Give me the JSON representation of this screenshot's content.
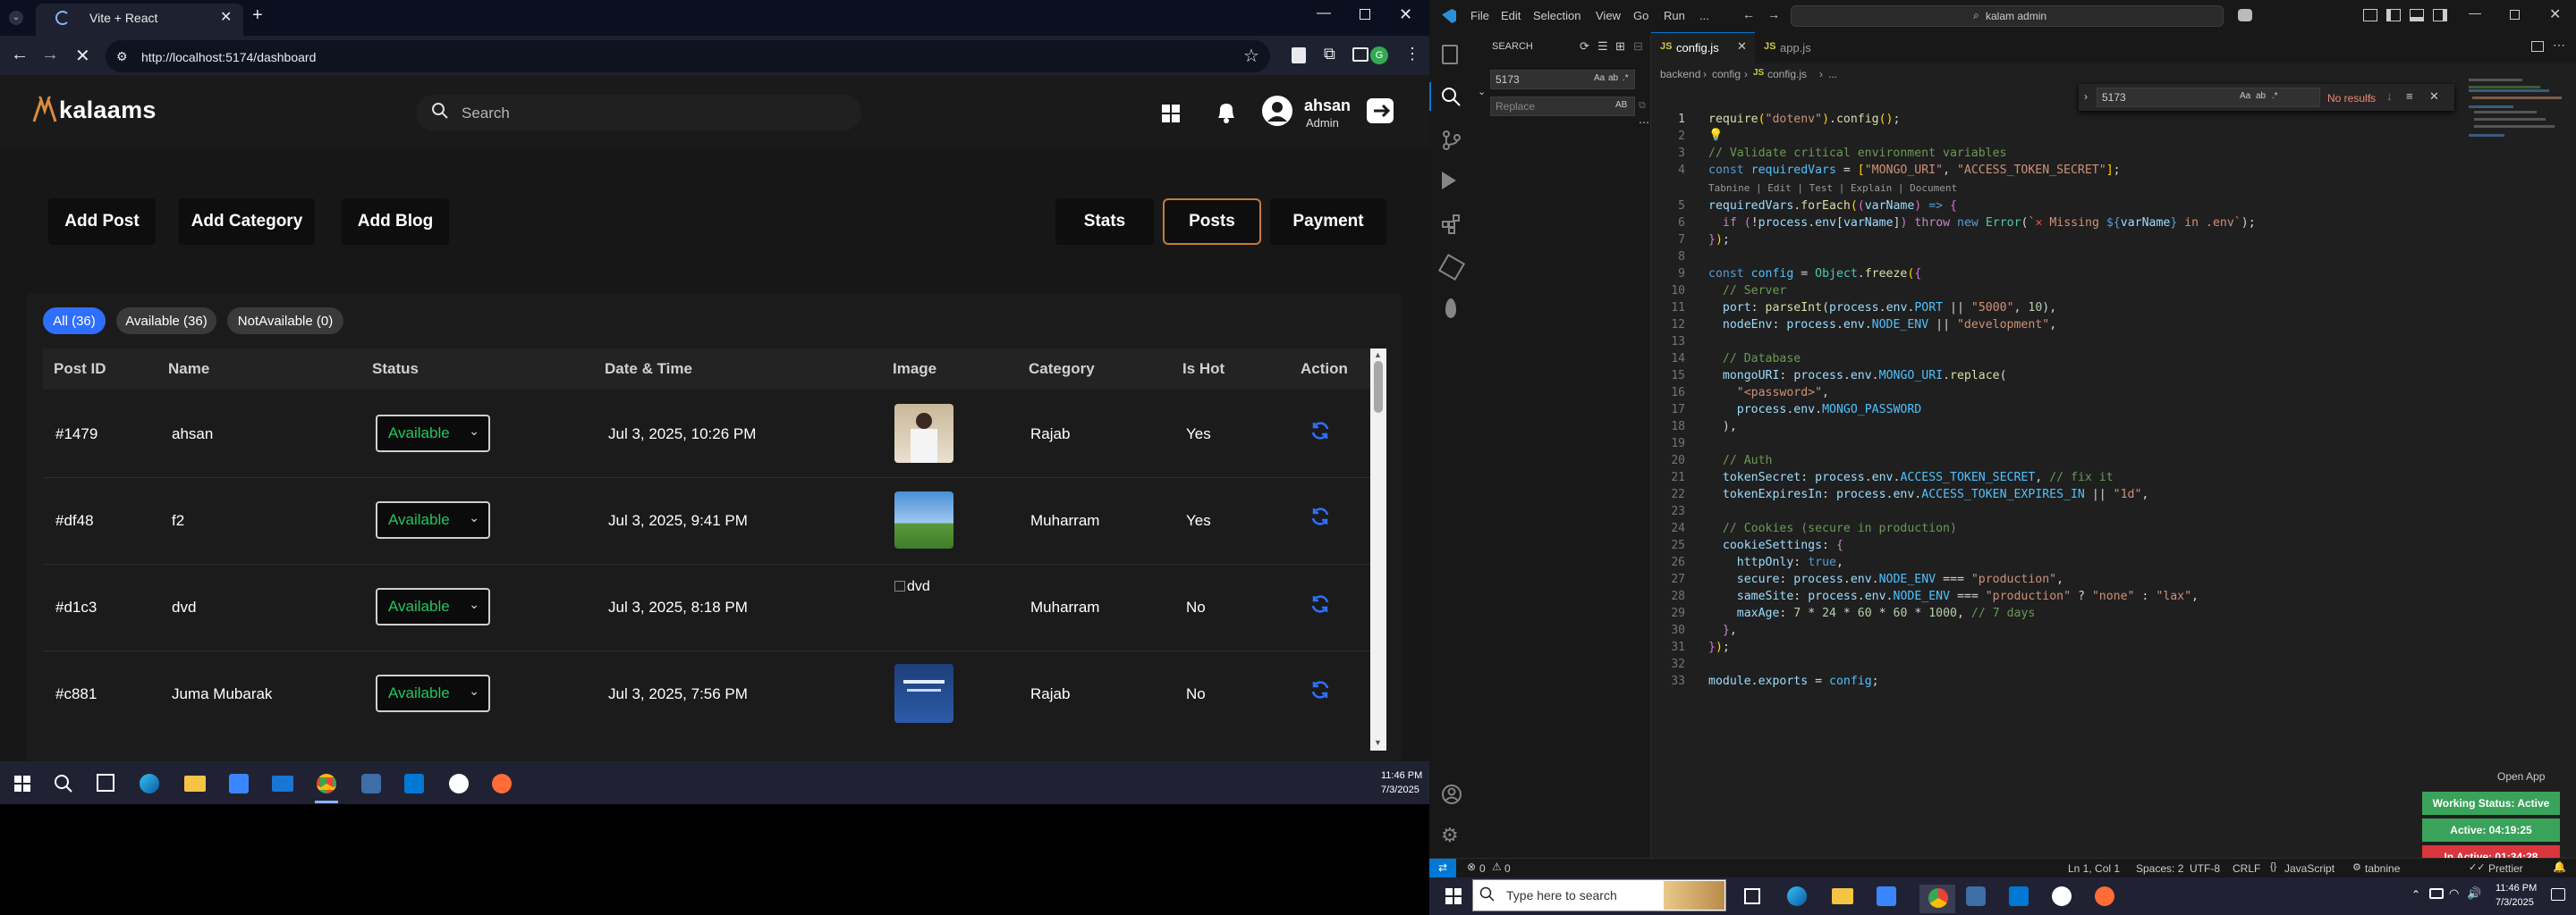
{
  "browser": {
    "tab_title": "Vite + React",
    "url": "http://localhost:5174/dashboard"
  },
  "app": {
    "logo": "kalaams",
    "search_placeholder": "Search",
    "user_name": "ahsan",
    "user_role": "Admin",
    "action_buttons": [
      "Add Post",
      "Add Category",
      "Add Blog"
    ],
    "view_buttons": [
      "Stats",
      "Posts",
      "Payment"
    ],
    "active_view": "Posts",
    "filters": [
      "All (36)",
      "Available (36)",
      "NotAvailable (0)"
    ],
    "columns": [
      "Post ID",
      "Name",
      "Status",
      "Date & Time",
      "Image",
      "Category",
      "Is Hot",
      "Action"
    ],
    "rows": [
      {
        "id": "#1479",
        "name": "ahsan",
        "status": "Available",
        "date": "Jul 3, 2025, 10:26 PM",
        "image_alt": "",
        "category": "Rajab",
        "is_hot": "Yes"
      },
      {
        "id": "#df48",
        "name": "f2",
        "status": "Available",
        "date": "Jul 3, 2025, 9:41 PM",
        "image_alt": "",
        "category": "Muharram",
        "is_hot": "Yes"
      },
      {
        "id": "#d1c3",
        "name": "dvd",
        "status": "Available",
        "date": "Jul 3, 2025, 8:18 PM",
        "image_alt": "dvd",
        "category": "Muharram",
        "is_hot": "No"
      },
      {
        "id": "#c881",
        "name": "Juma Mubarak",
        "status": "Available",
        "date": "Jul 3, 2025, 7:56 PM",
        "image_alt": "",
        "category": "Rajab",
        "is_hot": "No"
      }
    ],
    "colors": {
      "accent_blue": "#2f6fff",
      "available_green": "#22c55e",
      "active_border": "#c47b3c"
    }
  },
  "taskbar_left": {
    "time": "11:46 PM",
    "date": "7/3/2025"
  },
  "vscode": {
    "menu": [
      "File",
      "Edit",
      "Selection",
      "View",
      "Go",
      "Run",
      "..."
    ],
    "command_center": "kalam admin",
    "sidebar_title": "SEARCH",
    "search_value": "5173",
    "replace_placeholder": "Replace",
    "tabs": [
      "config.js",
      "app.js"
    ],
    "breadcrumb": [
      "backend",
      "config",
      "config.js",
      "..."
    ],
    "find_value": "5173",
    "find_result": "No results",
    "codelens": "Tabnine | Edit | Test | Explain | Document",
    "status": {
      "errors": "0",
      "warnings": "0",
      "position": "Ln 1, Col 1",
      "spaces": "Spaces: 2",
      "encoding": "UTF-8",
      "eol": "CRLF",
      "language": "JavaScript",
      "tabnine": "tabnine",
      "prettier": "Prettier"
    },
    "open_app": "Open App",
    "working_status": "Working Status: Active",
    "active_time": "Active: 04:19:25",
    "inactive_time": "In Active: 01:34:28"
  },
  "taskbar_right": {
    "search_placeholder": "Type here to search",
    "time": "11:46 PM",
    "date": "7/3/2025"
  }
}
